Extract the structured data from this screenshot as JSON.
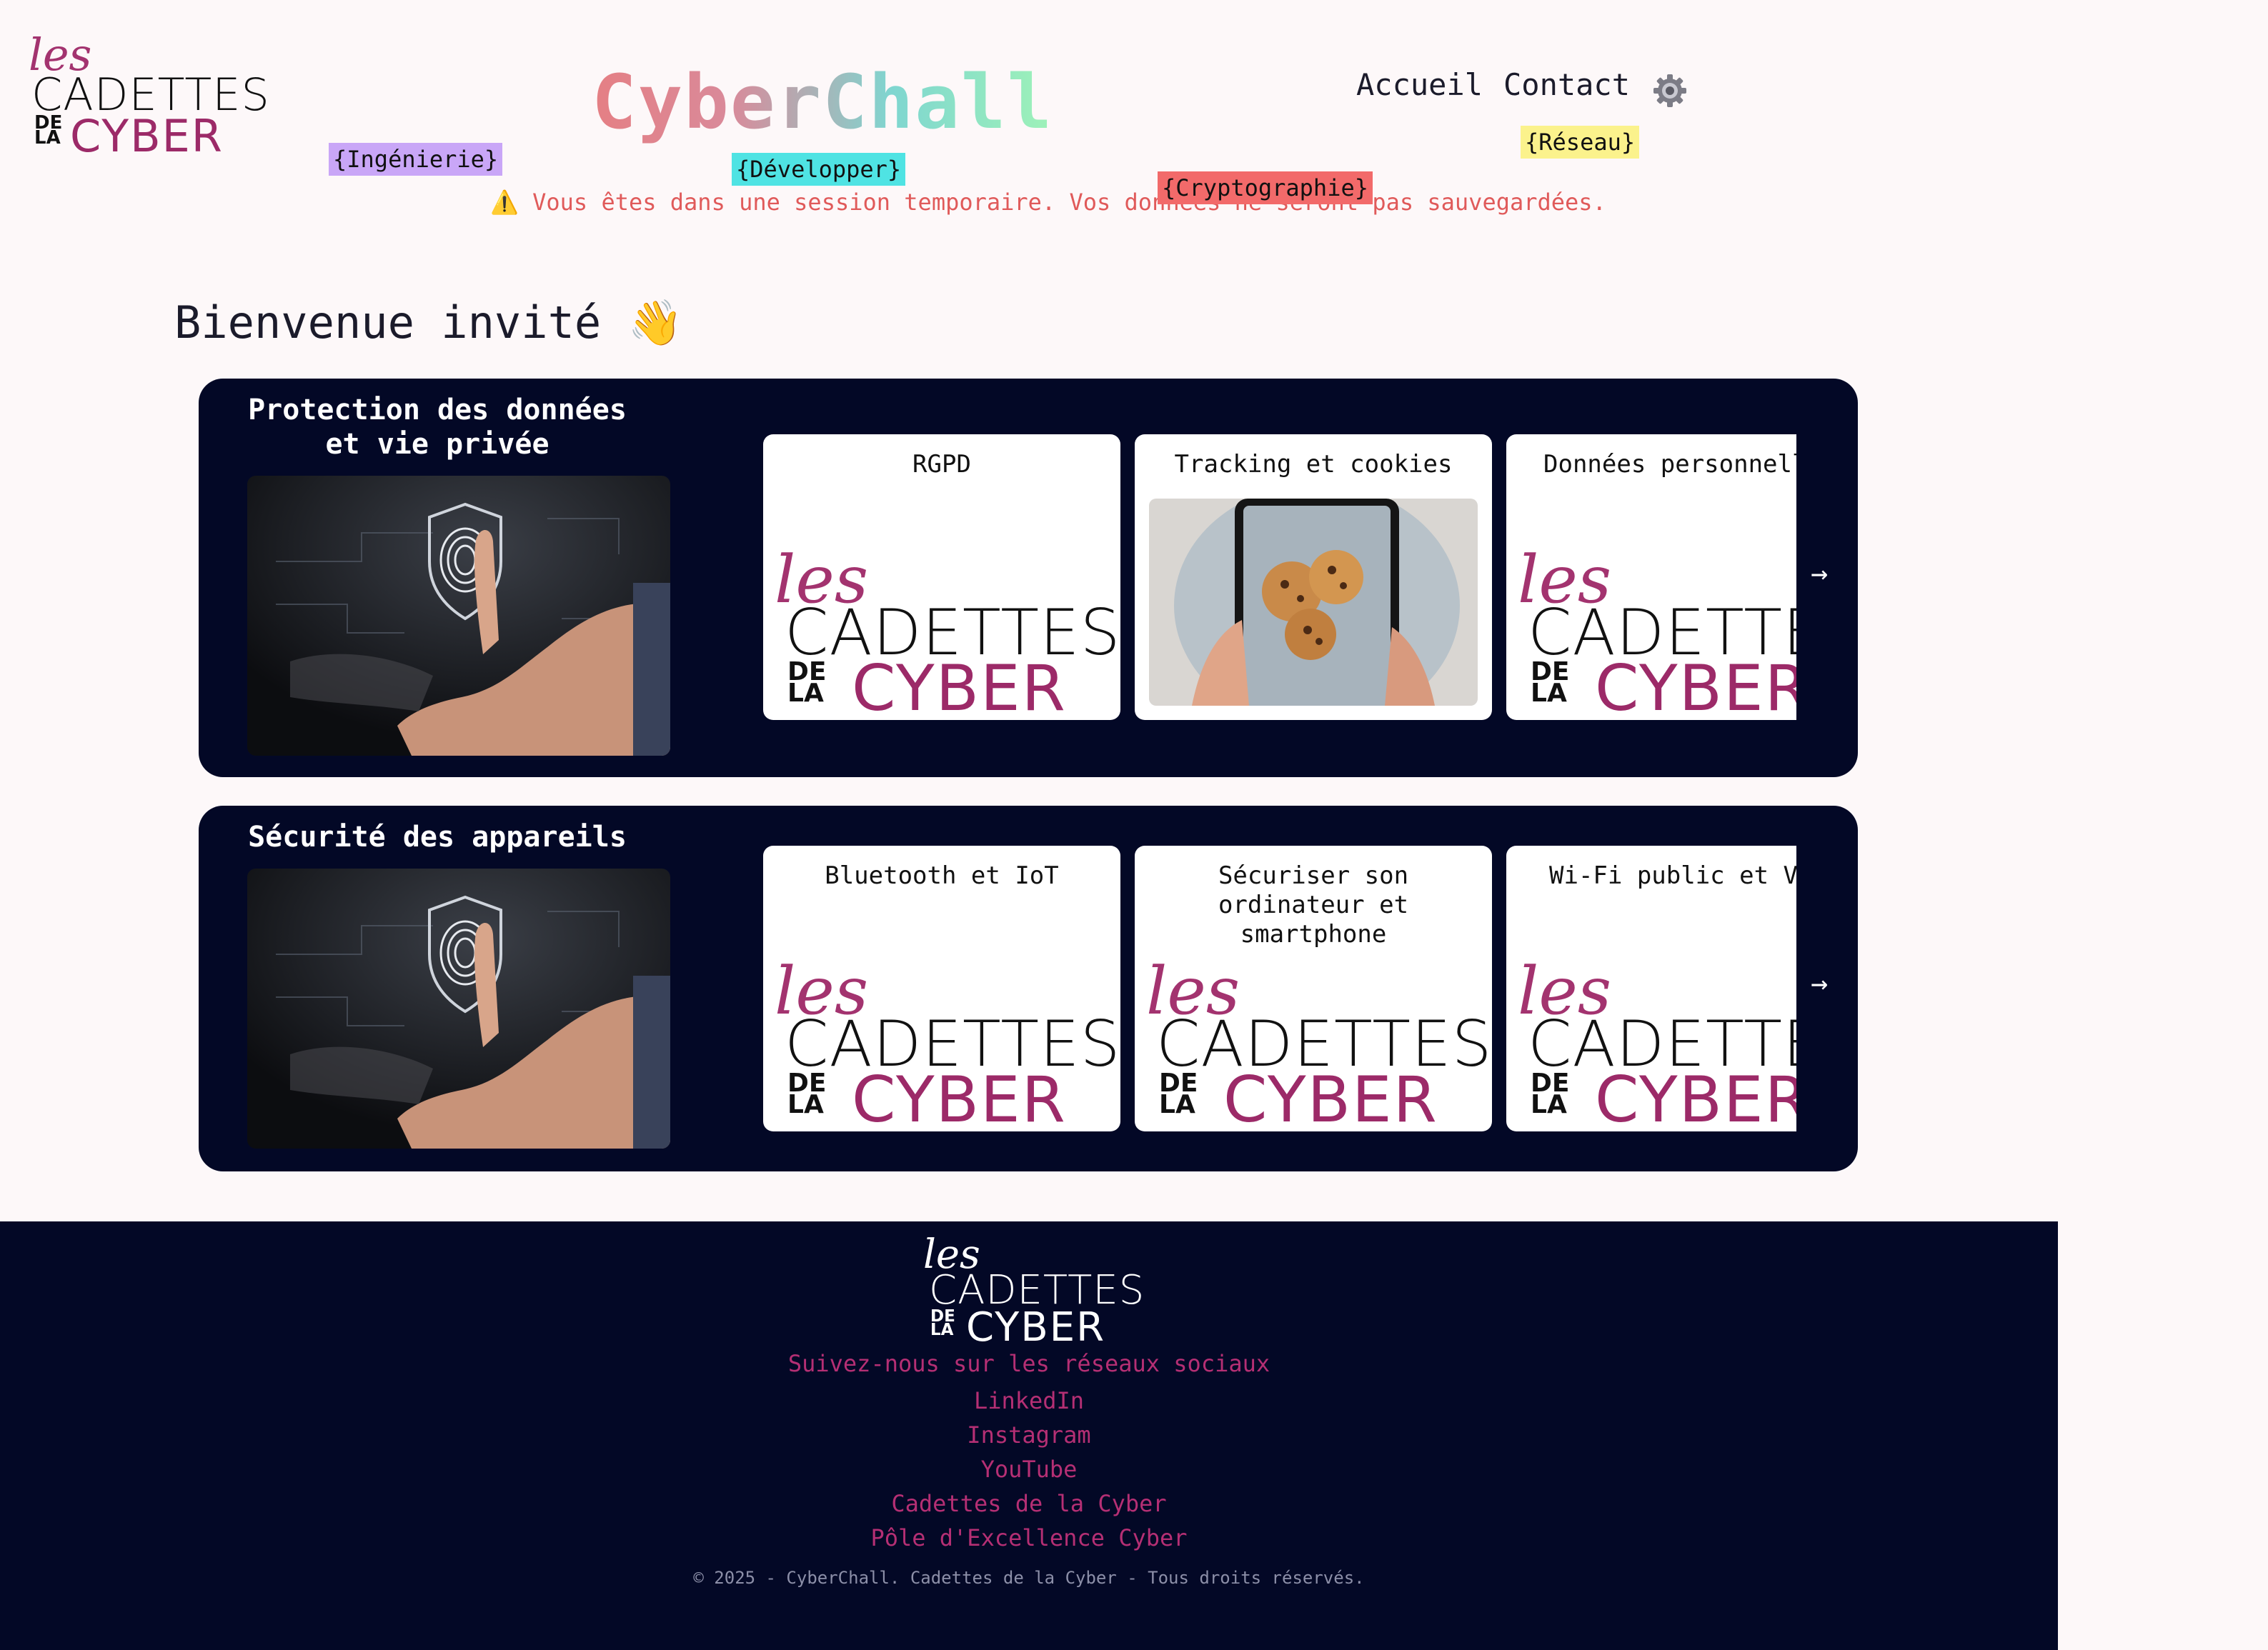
{
  "header": {
    "logo": {
      "les": "les",
      "cadettes": "CADETTES",
      "de": "DE",
      "la": "LA",
      "cyber": "CYBER"
    },
    "site_title": "CyberChall",
    "nav": [
      {
        "label": "Accueil"
      },
      {
        "label": "Contact"
      }
    ],
    "settings_icon": "gear-icon",
    "tags": [
      {
        "label": "{Ingénierie}",
        "color": "#c9a6f7"
      },
      {
        "label": "{Développer}",
        "color": "#4fe3e3"
      },
      {
        "label": "{Cryptographie}",
        "color": "#f26a6a"
      },
      {
        "label": "{Réseau}",
        "color": "#fbf28c"
      }
    ]
  },
  "warning": "⚠️ Vous êtes dans une session temporaire. Vos données ne seront pas sauvegardées.",
  "welcome": "Bienvenue invité 👋",
  "categories": [
    {
      "title": "Protection des données et vie privée",
      "cards": [
        {
          "title": "RGPD",
          "image": "cadettes-logo"
        },
        {
          "title": "Tracking et cookies",
          "image": "cookies-phone-photo"
        },
        {
          "title": "Données personnell",
          "image": "cadettes-logo"
        }
      ]
    },
    {
      "title": "Sécurité des appareils",
      "cards": [
        {
          "title": "Bluetooth et IoT",
          "image": "cadettes-logo"
        },
        {
          "title": "Sécuriser son ordinateur et smartphone",
          "image": "cadettes-logo"
        },
        {
          "title": "Wi-Fi public et VP",
          "image": "cadettes-logo"
        }
      ]
    }
  ],
  "next_arrow": "→",
  "footer": {
    "social_heading": "Suivez-nous sur les réseaux sociaux",
    "links": [
      {
        "label": "LinkedIn"
      },
      {
        "label": "Instagram"
      },
      {
        "label": "YouTube"
      },
      {
        "label": "Cadettes de la Cyber"
      },
      {
        "label": "Pôle d'Excellence Cyber"
      }
    ],
    "copyright": "© 2025 - CyberChall. Cadettes de la Cyber - Tous droits réservés."
  },
  "colors": {
    "background": "#fdf8f9",
    "panel": "#030826",
    "brand_magenta": "#9c2a68",
    "warning": "#e05a5a"
  }
}
